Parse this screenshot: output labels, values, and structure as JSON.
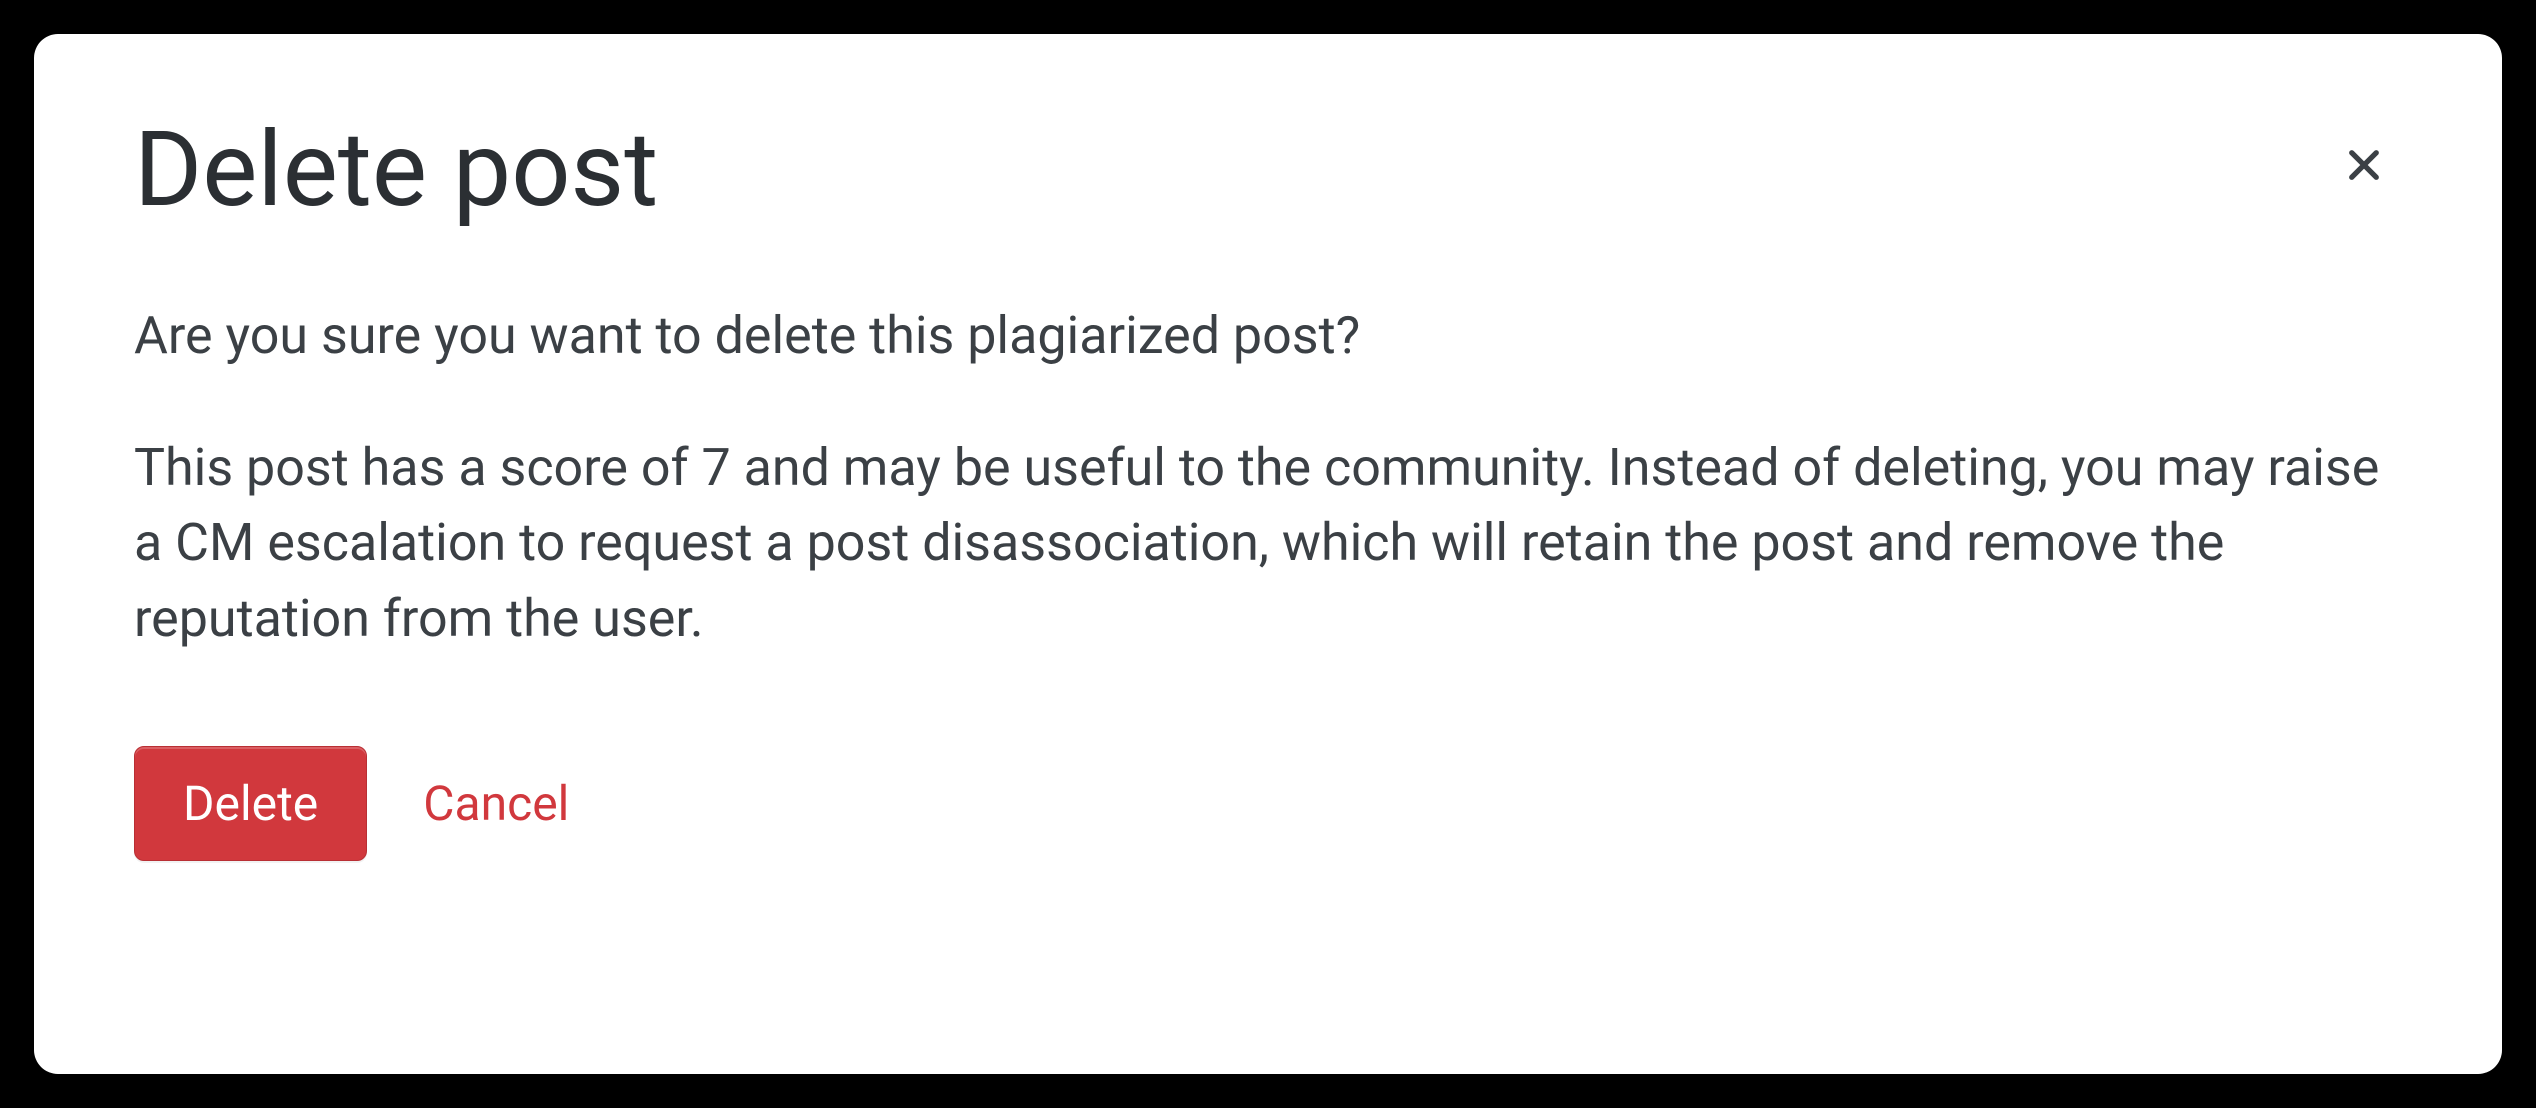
{
  "dialog": {
    "title": "Delete post",
    "paragraph1": "Are you sure you want to delete this plagiarized post?",
    "paragraph2": "This post has a score of 7 and may be useful to the community. Instead of deleting, you may raise a CM escalation to request a post disassociation, which will retain the post and remove the reputation from the user.",
    "delete_label": "Delete",
    "cancel_label": "Cancel"
  }
}
